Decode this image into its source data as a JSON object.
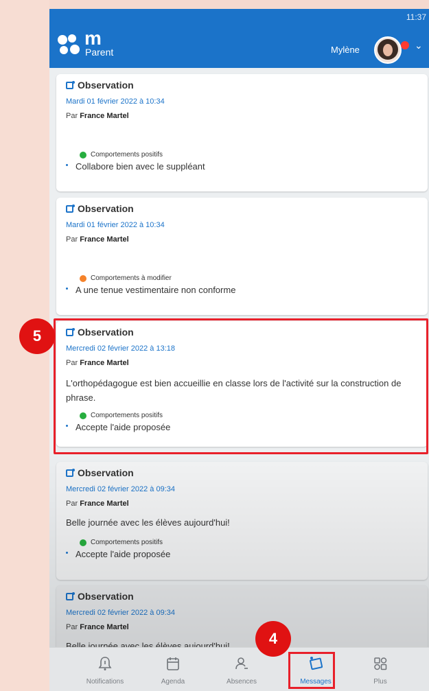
{
  "status": {
    "time": "11:37"
  },
  "header": {
    "logo_mark": "m",
    "logo_sub": "Parent",
    "user_name": "Mylène"
  },
  "cards": [
    {
      "type": "Observation",
      "date": "Mardi 01 février 2022 à 10:34",
      "author_prefix": "Par",
      "author": "France Martel",
      "comment": "",
      "behavior_type": "Comportements positifs",
      "behavior_color": "#27ae3f",
      "behavior_text": "Collabore bien avec le suppléant"
    },
    {
      "type": "Observation",
      "date": "Mardi 01 février 2022 à 10:34",
      "author_prefix": "Par",
      "author": "France Martel",
      "comment": "",
      "behavior_type": "Comportements à modifier",
      "behavior_color": "#f5822a",
      "behavior_text": "A une tenue vestimentaire non conforme"
    },
    {
      "type": "Observation",
      "date": "Mercredi 02 février 2022 à 13:18",
      "author_prefix": "Par",
      "author": "France Martel",
      "comment": "L'orthopédagogue est bien accueillie en classe lors de l'activité sur la construction de phrase.",
      "behavior_type": "Comportements positifs",
      "behavior_color": "#27ae3f",
      "behavior_text": "Accepte l'aide proposée"
    },
    {
      "type": "Observation",
      "date": "Mercredi 02 février 2022 à 09:34",
      "author_prefix": "Par",
      "author": "France Martel",
      "comment": "Belle journée avec les élèves aujourd'hui!",
      "behavior_type": "Comportements positifs",
      "behavior_color": "#27ae3f",
      "behavior_text": "Accepte l'aide proposée"
    },
    {
      "type": "Observation",
      "date": "Mercredi 02 février 2022 à 09:34",
      "author_prefix": "Par",
      "author": "France Martel",
      "comment": "Belle journée avec les élèves aujourd'hui!"
    }
  ],
  "annotations": {
    "step5": "5",
    "step4": "4"
  },
  "bottom_nav": [
    {
      "label": "Notifications",
      "icon": "bell-icon"
    },
    {
      "label": "Agenda",
      "icon": "calendar-icon"
    },
    {
      "label": "Absences",
      "icon": "person-icon"
    },
    {
      "label": "Messages",
      "icon": "messages-icon",
      "active": true
    },
    {
      "label": "Plus",
      "icon": "more-icon"
    }
  ],
  "colors": {
    "brand": "#1b73c9",
    "highlight": "#e8202a",
    "badge": "#e01212"
  }
}
